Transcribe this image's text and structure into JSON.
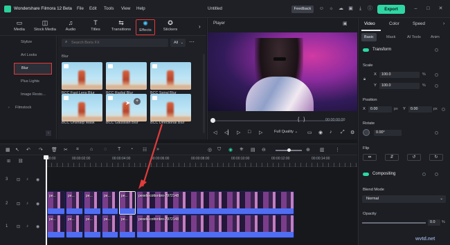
{
  "app": {
    "title": "Wondershare Filmora 12 Beta",
    "menu": [
      "File",
      "Edit",
      "Tools",
      "View",
      "Help"
    ],
    "project_title": "Untitled",
    "feedback_label": "Feedback",
    "export_label": "Export",
    "colors": {
      "accent": "#2fd6a4",
      "highlight": "#e23b3b",
      "clip": "#4f6ef3"
    }
  },
  "media_tabs": [
    {
      "label": "Media",
      "icon": "media-icon"
    },
    {
      "label": "Stock Media",
      "icon": "stock-media-icon"
    },
    {
      "label": "Audio",
      "icon": "music-note-icon"
    },
    {
      "label": "Titles",
      "icon": "text-icon"
    },
    {
      "label": "Transitions",
      "icon": "transitions-icon"
    },
    {
      "label": "Effects",
      "icon": "effects-icon"
    },
    {
      "label": "Stickers",
      "icon": "stickers-icon"
    }
  ],
  "effects_nav": {
    "items": [
      "Stylize",
      "Art Looks",
      "Blur",
      "Plus Lights",
      "Image Resto..."
    ],
    "selected": "Blur",
    "filmstock": "Filmstock"
  },
  "effects_panel": {
    "search_placeholder": "Search Boris FX",
    "filter": "All",
    "category": "Blur",
    "effects": [
      "BCC Fast Lens Blur",
      "BCC Radial Blur",
      "BCC Spiral Blur",
      "BCC Unsharp Mask",
      "BCC Gaussian Blur",
      "BCC Directional Blur"
    ]
  },
  "player": {
    "label": "Player",
    "timecode": "00:00:00:00",
    "quality": "Full Quality"
  },
  "properties": {
    "tabs": [
      "Video",
      "Color",
      "Speed"
    ],
    "subtabs": [
      "Basic",
      "Mask",
      "AI Tools",
      "Anim"
    ],
    "transform": "Transform",
    "scale": {
      "label": "Scale",
      "x": "100.0",
      "y": "100.0",
      "unit": "%"
    },
    "position": {
      "label": "Position",
      "x": "0.00",
      "y": "0.00",
      "unit": "px"
    },
    "rotate": {
      "label": "Rotate",
      "value": "0.00°"
    },
    "flip": "Flip",
    "compositing": "Compositing",
    "blend_mode": {
      "label": "Blend Mode",
      "value": "Normal"
    },
    "opacity": {
      "label": "Opacity",
      "value": "0.0",
      "unit": "%",
      "level": 1.0
    }
  },
  "timeline": {
    "ruler": [
      "00:00",
      "00:00:02:00",
      "00:00:04:00",
      "00:00:06:00",
      "00:00:08:00",
      "00:00:10:00",
      "00:00:12:00",
      "00:00:14:00"
    ],
    "track_labels": [
      "3",
      "2",
      "1"
    ],
    "clip_label": "pexels-cottonbro-7972148",
    "short_label": "pe..."
  },
  "watermark": "wvtd.net"
}
